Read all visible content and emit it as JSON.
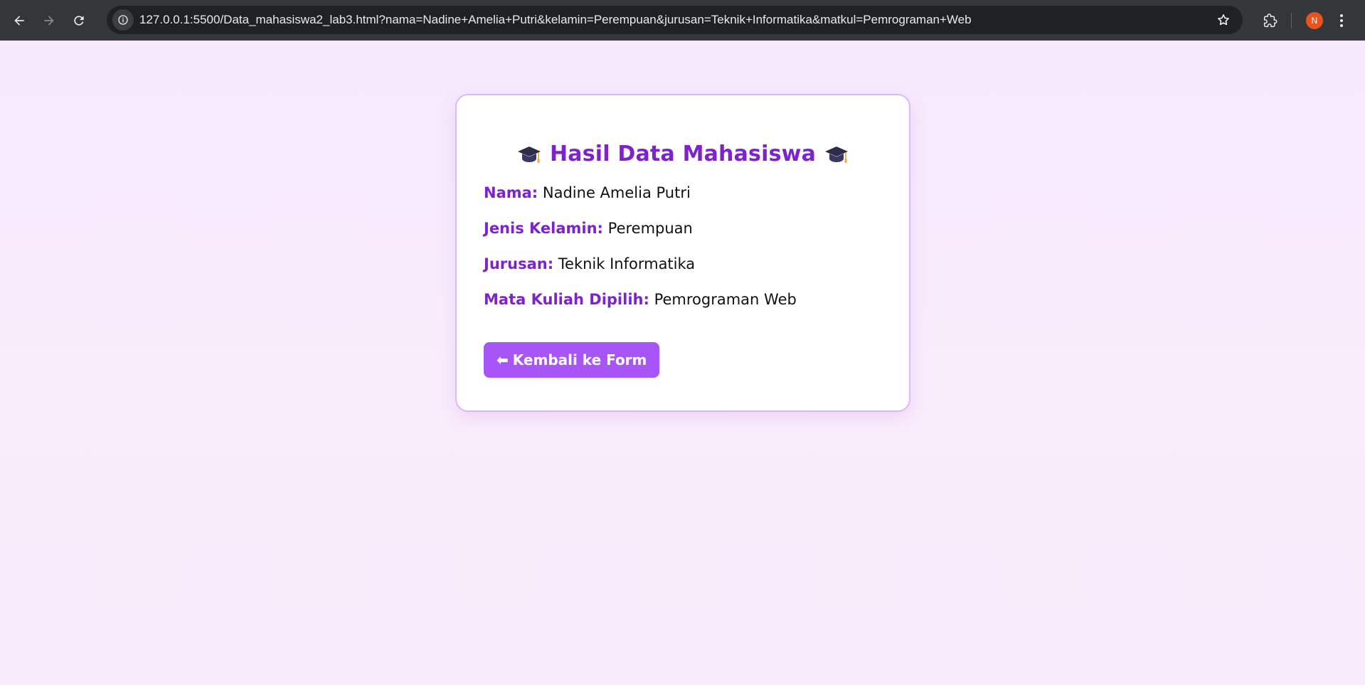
{
  "browser": {
    "url": "127.0.0.1:5500/Data_mahasiswa2_lab3.html?nama=Nadine+Amelia+Putri&kelamin=Perempuan&jurusan=Teknik+Informatika&matkul=Pemrograman+Web",
    "profile_initial": "N"
  },
  "card": {
    "title": "Hasil Data Mahasiswa",
    "fields": [
      {
        "label": "Nama:",
        "value": "Nadine Amelia Putri"
      },
      {
        "label": "Jenis Kelamin:",
        "value": "Perempuan"
      },
      {
        "label": "Jurusan:",
        "value": "Teknik Informatika"
      },
      {
        "label": "Mata Kuliah Dipilih:",
        "value": "Pemrograman Web"
      }
    ],
    "back_button_label": "Kembali ke Form",
    "back_button_arrow": "⬅"
  },
  "colors": {
    "accent": "#7e22ce",
    "button": "#a855f7",
    "card_border": "#dcb7f6",
    "background": "#f6eafc"
  }
}
